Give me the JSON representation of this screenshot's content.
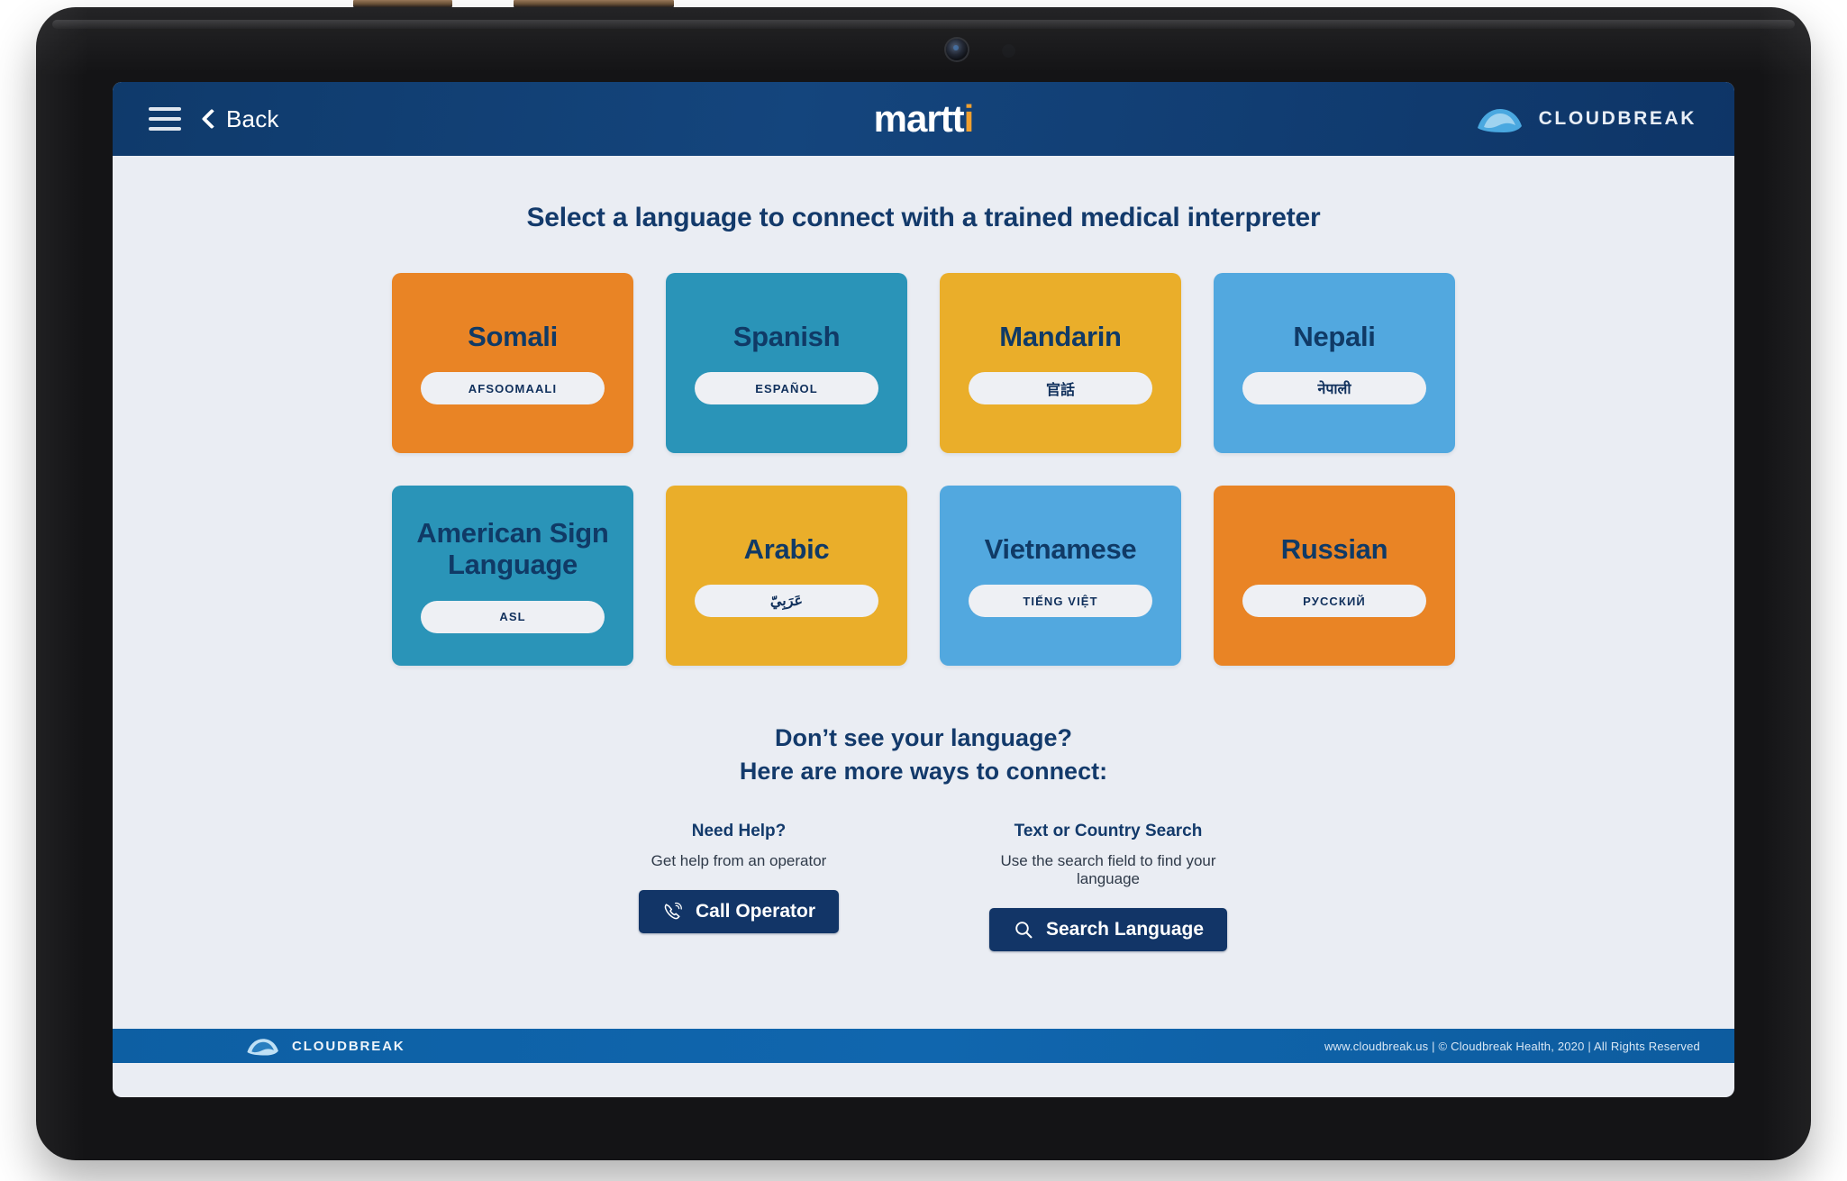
{
  "header": {
    "menu_icon": "hamburger-menu-icon",
    "back_label": "Back",
    "brand_main": "martt",
    "brand_accent": "i",
    "cloudbreak_label": "CLOUDBREAK",
    "cloudbreak_icon": "cloudbreak-wave-icon"
  },
  "main": {
    "title": "Select a language to connect with a trained medical interpreter",
    "languages": [
      {
        "name": "Somali",
        "native": "AFSOOMAALI",
        "color": "#e98425",
        "script": false
      },
      {
        "name": "Spanish",
        "native": "ESPAÑOL",
        "color": "#2a94b8",
        "script": false
      },
      {
        "name": "Mandarin",
        "native": "官話",
        "color": "#eaae2a",
        "script": true
      },
      {
        "name": "Nepali",
        "native": "नेपाली",
        "color": "#52a8df",
        "script": true
      },
      {
        "name": "American Sign Language",
        "native": "ASL",
        "color": "#2a94b8",
        "script": false
      },
      {
        "name": "Arabic",
        "native": "عَرَبِيّ",
        "color": "#eaae2a",
        "script": true
      },
      {
        "name": "Vietnamese",
        "native": "TIẾNG VIỆT",
        "color": "#52a8df",
        "script": false
      },
      {
        "name": "Russian",
        "native": "РУССКИЙ",
        "color": "#e98425",
        "script": false
      }
    ],
    "more_ways_line1": "Don’t see your language?",
    "more_ways_line2": "Here are more ways to connect:",
    "help_options": [
      {
        "title": "Need Help?",
        "subtitle": "Get help from an operator",
        "button_label": "Call Operator",
        "button_icon": "phone-call-icon"
      },
      {
        "title": "Text or Country Search",
        "subtitle": "Use the search field to find your language",
        "button_label": "Search Language",
        "button_icon": "search-icon"
      }
    ]
  },
  "footer": {
    "cloudbreak_label": "CLOUDBREAK",
    "cloudbreak_icon": "cloudbreak-wave-icon",
    "legal": "www.cloudbreak.us  |  © Cloudbreak Health, 2020  |  All Rights Reserved"
  },
  "theme": {
    "header_blue": "#14457d",
    "footer_blue": "#1066ae",
    "screen_bg": "#eaedf3",
    "text_navy": "#133a6b",
    "button_navy": "#123567",
    "accent_orange": "#f0a030"
  }
}
